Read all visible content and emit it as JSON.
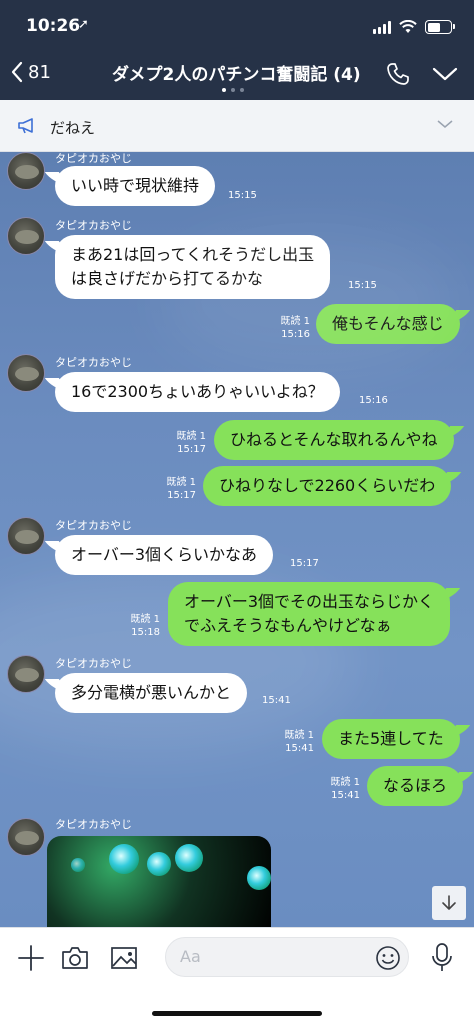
{
  "status_bar": {
    "time": "10:26"
  },
  "header": {
    "back_count": "81",
    "title": "ダメプ2人のパチンコ奮闘記 (4)"
  },
  "announcement": {
    "text": "だねえ"
  },
  "messages": [
    {
      "sender": "タピオカおやじ",
      "text": "いい時で現状維持",
      "time": "15:15"
    },
    {
      "sender": "タピオカおやじ",
      "line1": "まあ21は回ってくれそうだし出玉",
      "line2": "は良さげだから打てるかな",
      "time": "15:15"
    },
    {
      "read": "既読 1",
      "time": "15:16",
      "text": "俺もそんな感じ"
    },
    {
      "sender": "タピオカおやじ",
      "text": "16で2300ちょいありゃいいよね？",
      "time": "15:16"
    },
    {
      "read": "既読 1",
      "time": "15:17",
      "text": "ひねるとそんな取れるんやね"
    },
    {
      "read": "既読 1",
      "time": "15:17",
      "text": "ひねりなしで2260くらいだわ"
    },
    {
      "sender": "タピオカおやじ",
      "text": "オーバー3個くらいかなあ",
      "time": "15:17"
    },
    {
      "read": "既読 1",
      "time": "15:18",
      "line1": "オーバー3個でその出玉ならじかく",
      "line2": "でふえそうなもんやけどなぁ"
    },
    {
      "sender": "タピオカおやじ",
      "text": "多分電横が悪いんかと",
      "time": "15:41"
    },
    {
      "read": "既読 1",
      "time": "15:41",
      "text": "また5連してた"
    },
    {
      "read": "既読 1",
      "time": "15:41",
      "text": "なるほろ"
    },
    {
      "sender": "タピオカおやじ"
    }
  ],
  "input": {
    "placeholder": "Aa"
  },
  "colors": {
    "header_bg": "#263247",
    "outgoing_bubble": "#86e15a",
    "incoming_bubble": "#ffffff",
    "chat_bg": "#6b8cbf"
  }
}
